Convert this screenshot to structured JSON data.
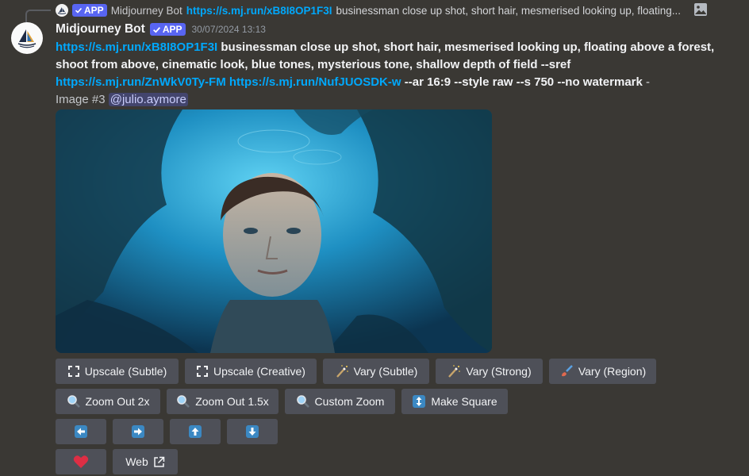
{
  "reply": {
    "bot_name": "Midjourney Bot",
    "app_badge": "APP",
    "link": "https://s.mj.run/xB8I8OP1F3I",
    "text": "businessman close up shot, short hair, mesmerised looking up, floating..."
  },
  "message": {
    "author": "Midjourney Bot",
    "app_badge": "APP",
    "timestamp": "30/07/2024 13:13",
    "link1": "https://s.mj.run/xB8I8OP1F3I",
    "prompt": "businessman close up shot, short hair, mesmerised looking up, floating above a forest, shoot from above, cinematic look, blue tones, mysterious tone, shallow depth of field --sref",
    "link2": "https://s.mj.run/ZnWkV0Ty-FM",
    "link3": "https://s.mj.run/NufJUOSDK-w",
    "params": "--ar 16:9 --style raw --s 750 --no watermark",
    "dash": "-",
    "image_label": "Image #3",
    "mention": "@julio.aymore"
  },
  "buttons": {
    "upscale_subtle": "Upscale (Subtle)",
    "upscale_creative": "Upscale (Creative)",
    "vary_subtle": "Vary (Subtle)",
    "vary_strong": "Vary (Strong)",
    "vary_region": "Vary (Region)",
    "zoom_out_2x": "Zoom Out 2x",
    "zoom_out_1_5x": "Zoom Out 1.5x",
    "custom_zoom": "Custom Zoom",
    "make_square": "Make Square",
    "web": "Web"
  },
  "colors": {
    "background": "#3a3834",
    "link": "#00a8fc",
    "button": "#4e5058",
    "app_badge": "#5865f2",
    "arrow_icon": "#3b88c3",
    "heart": "#dd2e44"
  }
}
